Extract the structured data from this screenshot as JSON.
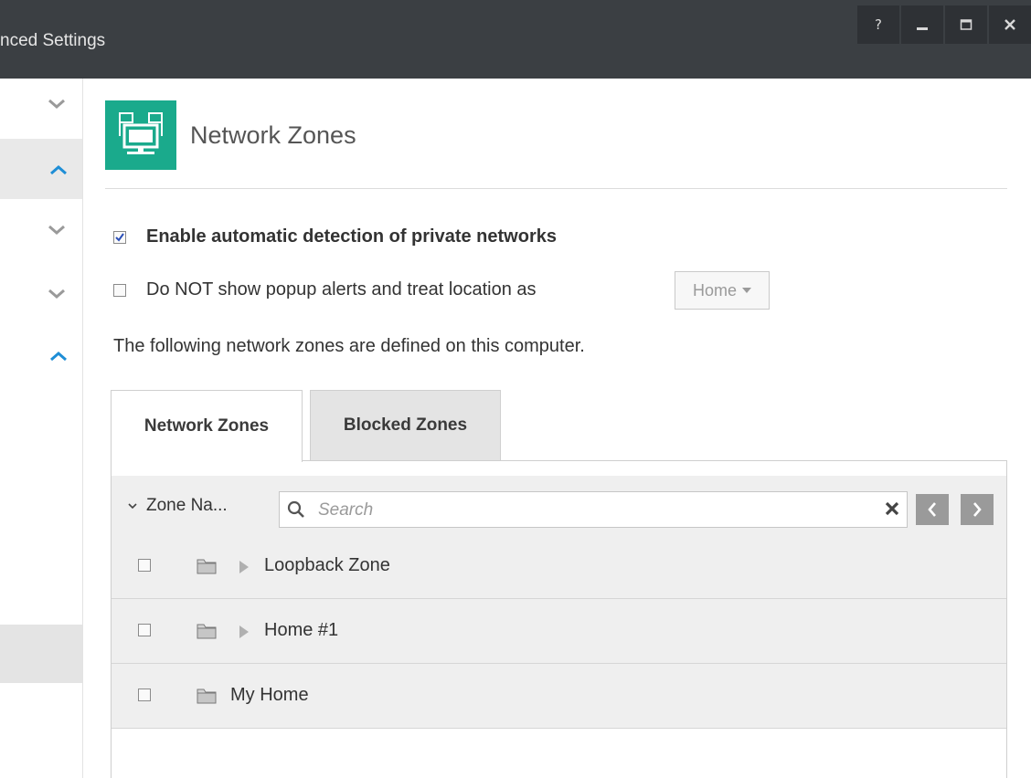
{
  "window": {
    "title": "nced Settings",
    "buttons": {
      "help": "?",
      "minimize": "minimize",
      "maximize": "maximize",
      "close": "close"
    }
  },
  "rail": {
    "items": [
      {
        "icon": "chevron-down-icon",
        "selected": false
      },
      {
        "icon": "chevron-up-icon",
        "selected": true
      },
      {
        "icon": "chevron-down-icon",
        "selected": false
      },
      {
        "icon": "chevron-down-icon",
        "selected": false
      },
      {
        "icon": "chevron-up-icon",
        "selected": false
      }
    ]
  },
  "header": {
    "title": "Network Zones",
    "icon": "network-monitor-icon",
    "accent": "#1aaa8c"
  },
  "options": {
    "auto_detect": {
      "label": "Enable automatic detection of private networks",
      "checked": true
    },
    "no_popup": {
      "label": "Do NOT show popup alerts and treat location as",
      "checked": false
    },
    "location_select": {
      "value": "Home"
    }
  },
  "description": "The following network zones are defined on this computer.",
  "tabs": [
    {
      "label": "Network Zones",
      "active": true
    },
    {
      "label": "Blocked Zones",
      "active": false
    }
  ],
  "toolbar": {
    "column_label": "Zone Na...",
    "search_placeholder": "Search"
  },
  "zones": [
    {
      "name": "Loopback Zone",
      "expandable": true,
      "checked": false
    },
    {
      "name": "Home #1",
      "expandable": true,
      "checked": false
    },
    {
      "name": "My Home",
      "expandable": false,
      "checked": false
    }
  ]
}
